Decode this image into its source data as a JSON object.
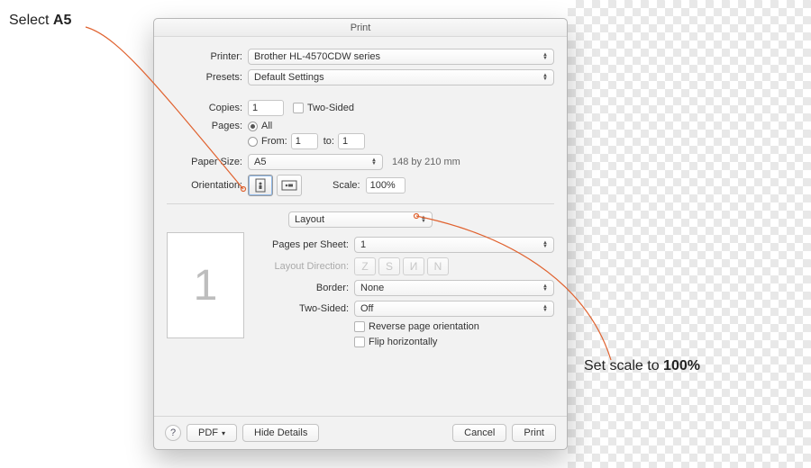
{
  "window": {
    "title": "Print"
  },
  "annotations": {
    "select_a5_prefix": "Select ",
    "select_a5_bold": "A5",
    "set_scale_prefix": "Set scale to ",
    "set_scale_bold": "100%"
  },
  "fields": {
    "printer_label": "Printer:",
    "printer_value": "Brother HL-4570CDW series",
    "presets_label": "Presets:",
    "presets_value": "Default Settings",
    "copies_label": "Copies:",
    "copies_value": "1",
    "two_sided_label": "Two-Sided",
    "pages_label": "Pages:",
    "pages_all": "All",
    "pages_from": "From:",
    "pages_from_value": "1",
    "pages_to": "to:",
    "pages_to_value": "1",
    "paper_size_label": "Paper Size:",
    "paper_size_value": "A5",
    "paper_size_dims": "148 by 210 mm",
    "orientation_label": "Orientation:",
    "scale_label": "Scale:",
    "scale_value": "100%",
    "section_select": "Layout",
    "pps_label": "Pages per Sheet:",
    "pps_value": "1",
    "layout_dir_label": "Layout Direction:",
    "border_label": "Border:",
    "border_value": "None",
    "two_sided2_label": "Two-Sided:",
    "two_sided2_value": "Off",
    "reverse_label": "Reverse page orientation",
    "flip_label": "Flip horizontally",
    "preview_page": "1"
  },
  "footer": {
    "help": "?",
    "pdf": "PDF",
    "hide_details": "Hide Details",
    "cancel": "Cancel",
    "print": "Print"
  }
}
